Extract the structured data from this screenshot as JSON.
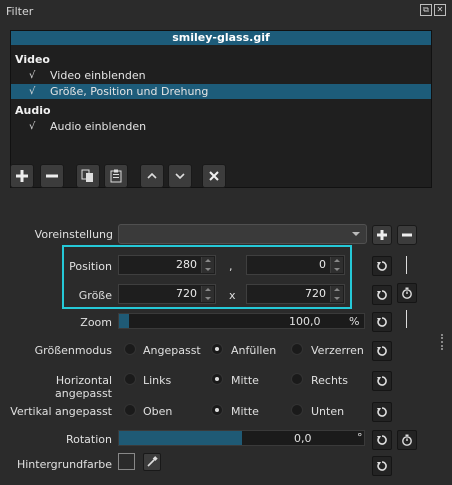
{
  "window": {
    "title": "Filter"
  },
  "filter_list": {
    "file": "smiley-glass.gif",
    "sections": [
      {
        "name": "Video",
        "items": [
          {
            "label": "Video einblenden",
            "checked": true,
            "selected": false
          },
          {
            "label": "Größe, Position und Drehung",
            "checked": true,
            "selected": true
          }
        ]
      },
      {
        "name": "Audio",
        "items": [
          {
            "label": "Audio einblenden",
            "checked": true,
            "selected": false
          }
        ]
      }
    ],
    "check_glyph": "√"
  },
  "toolbar": {
    "icons": [
      "add-icon",
      "remove-icon",
      "copy-icon",
      "paste-icon",
      "move-up-icon",
      "move-down-icon",
      "deselect-icon"
    ]
  },
  "preset": {
    "label": "Voreinstellung",
    "value": ""
  },
  "position": {
    "label": "Position",
    "x": "280",
    "sep": ",",
    "y": "0"
  },
  "size": {
    "label": "Größe",
    "w": "720",
    "sep": "x",
    "h": "720"
  },
  "zoom": {
    "label": "Zoom",
    "value": "100,0",
    "unit": "%",
    "fraction": 0.04
  },
  "size_mode": {
    "label": "Größenmodus",
    "options": [
      "Angepasst",
      "Anfüllen",
      "Verzerren"
    ],
    "selected": 1
  },
  "h_fit": {
    "label": "Horizontal angepasst",
    "options": [
      "Links",
      "Mitte",
      "Rechts"
    ],
    "selected": 1
  },
  "v_fit": {
    "label": "Vertikal angepasst",
    "options": [
      "Oben",
      "Mitte",
      "Unten"
    ],
    "selected": 1
  },
  "rotation": {
    "label": "Rotation",
    "value": "0,0",
    "unit": "°",
    "fraction": 0.5
  },
  "background": {
    "label": "Hintergrundfarbe",
    "color": "#2b2b2b"
  },
  "colors": {
    "accent": "#1d5c7a",
    "highlight": "#25c9d8"
  }
}
